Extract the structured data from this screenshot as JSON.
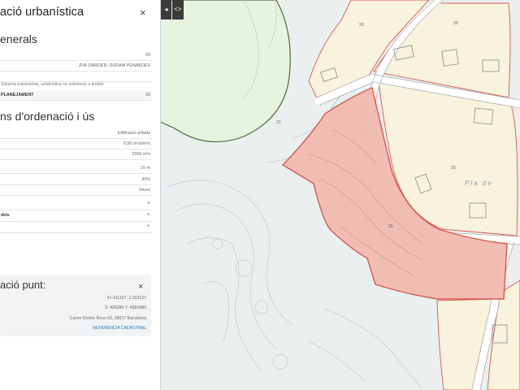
{
  "panel": {
    "title": "ació urbanística",
    "close_glyph": "×",
    "section_general": "enerals",
    "general_rows": [
      {
        "label": "",
        "value": "20"
      },
      {
        "label": "",
        "value": "ZH5 DARDER, DUDAM PENAKDES"
      },
      {
        "label": "",
        "value": ""
      }
    ],
    "general_note": "Sistema subsistema, urbanística no sotmesos a àmbits",
    "general_bold_row": {
      "label": "PLANEJAMENT",
      "value": "20"
    },
    "section_ordenacio": "ns d'ordenació i ús",
    "ordenacio_rows": [
      {
        "label": "",
        "value": "Edificació aïllada"
      },
      {
        "label": "",
        "value": "0,50 m²st/m²s"
      },
      {
        "label": "",
        "value": "2000 m²s"
      },
      {
        "label": "",
        "value": "10 m"
      },
      {
        "label": "",
        "value": "30%"
      },
      {
        "label": "",
        "value": "Veure"
      }
    ],
    "expand_rows": [
      {
        "label": "",
        "glyph": "+"
      },
      {
        "label": "dels",
        "glyph": "+"
      },
      {
        "label": "",
        "glyph": "+"
      }
    ]
  },
  "info": {
    "title": "ació punt:",
    "close_glyph": "×",
    "rows": [
      {
        "label": "",
        "value": "41.411167, 2.103127"
      },
      {
        "label": "",
        "value": "X: 426280  Y: 4583480"
      },
      {
        "label": "",
        "value": "Carrer Doctor Roux 53, 08017 Barcelona"
      },
      {
        "label": "",
        "value": "REFERÈNCIA CADASTRAL",
        "link": true
      }
    ]
  },
  "map_controls": {
    "collapse_glyph": "◂",
    "resize_glyph": "<>"
  },
  "map_labels": {
    "zone_key_1": "20",
    "zone_key_2": "20",
    "zone_key_3": "20",
    "zone_key_4": "20",
    "parcel_key": "20",
    "street_label": "Pla de"
  },
  "colors": {
    "map_background": "#eceff0",
    "green_zone": "#e7f2df",
    "urban_block": "#f7f3dc",
    "selected_parcel": "#f1b8ad",
    "selected_border": "#d9584c",
    "road": "#ffffff",
    "link": "#2a74b8"
  }
}
